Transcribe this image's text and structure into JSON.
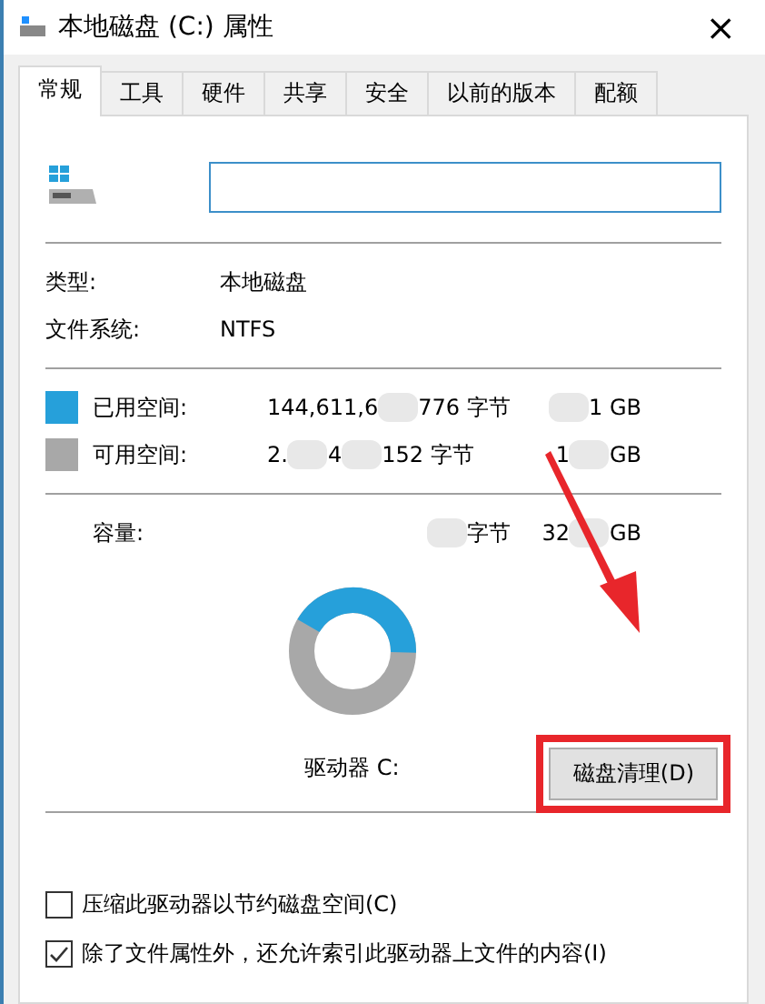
{
  "window": {
    "title": "本地磁盘 (C:) 属性",
    "close": "×"
  },
  "tabs": [
    {
      "label": "常规",
      "selected": true
    },
    {
      "label": "工具",
      "selected": false
    },
    {
      "label": "硬件",
      "selected": false
    },
    {
      "label": "共享",
      "selected": false
    },
    {
      "label": "安全",
      "selected": false
    },
    {
      "label": "以前的版本",
      "selected": false
    },
    {
      "label": "配额",
      "selected": false
    }
  ],
  "info": [
    {
      "label": "类型:",
      "value": "本地磁盘"
    },
    {
      "label": "文件系统:",
      "value": "NTFS"
    }
  ],
  "space": [
    {
      "label": "已用空间:",
      "color": "#26a0da",
      "bytes": [
        {
          "kind": "text",
          "text": "144,611,6"
        },
        {
          "kind": "blur"
        },
        {
          "kind": "text",
          "text": "776 字节"
        }
      ],
      "size": [
        {
          "kind": "blur"
        },
        {
          "kind": "text",
          "text": "1 GB"
        }
      ]
    },
    {
      "label": "可用空间:",
      "color": "#a8a8a8",
      "bytes": [
        {
          "kind": "text",
          "text": "2."
        },
        {
          "kind": "blur"
        },
        {
          "kind": "text",
          "text": "4"
        },
        {
          "kind": "blur"
        },
        {
          "kind": "text",
          "text": "152 字节"
        }
      ],
      "size": [
        {
          "kind": "text",
          "text": "1"
        },
        {
          "kind": "blur"
        },
        {
          "kind": "text",
          "text": "GB"
        }
      ]
    }
  ],
  "capacity": {
    "label": "容量:",
    "bytes": [
      {
        "kind": "blur"
      },
      {
        "kind": "text",
        "text": "字节"
      }
    ],
    "size": [
      {
        "kind": "text",
        "text": "32"
      },
      {
        "kind": "blur"
      },
      {
        "kind": "text",
        "text": "GB"
      }
    ]
  },
  "donut": {
    "level": 0.42
  },
  "drive_label": "驱动器 C:",
  "cleanup_button": "磁盘清理(D)",
  "options": [
    {
      "label": "压缩此驱动器以节约磁盘空间(C)",
      "checked": false
    },
    {
      "label": "除了文件属性外，还允许索引此驱动器上文件的内容(I)",
      "checked": true
    }
  ]
}
